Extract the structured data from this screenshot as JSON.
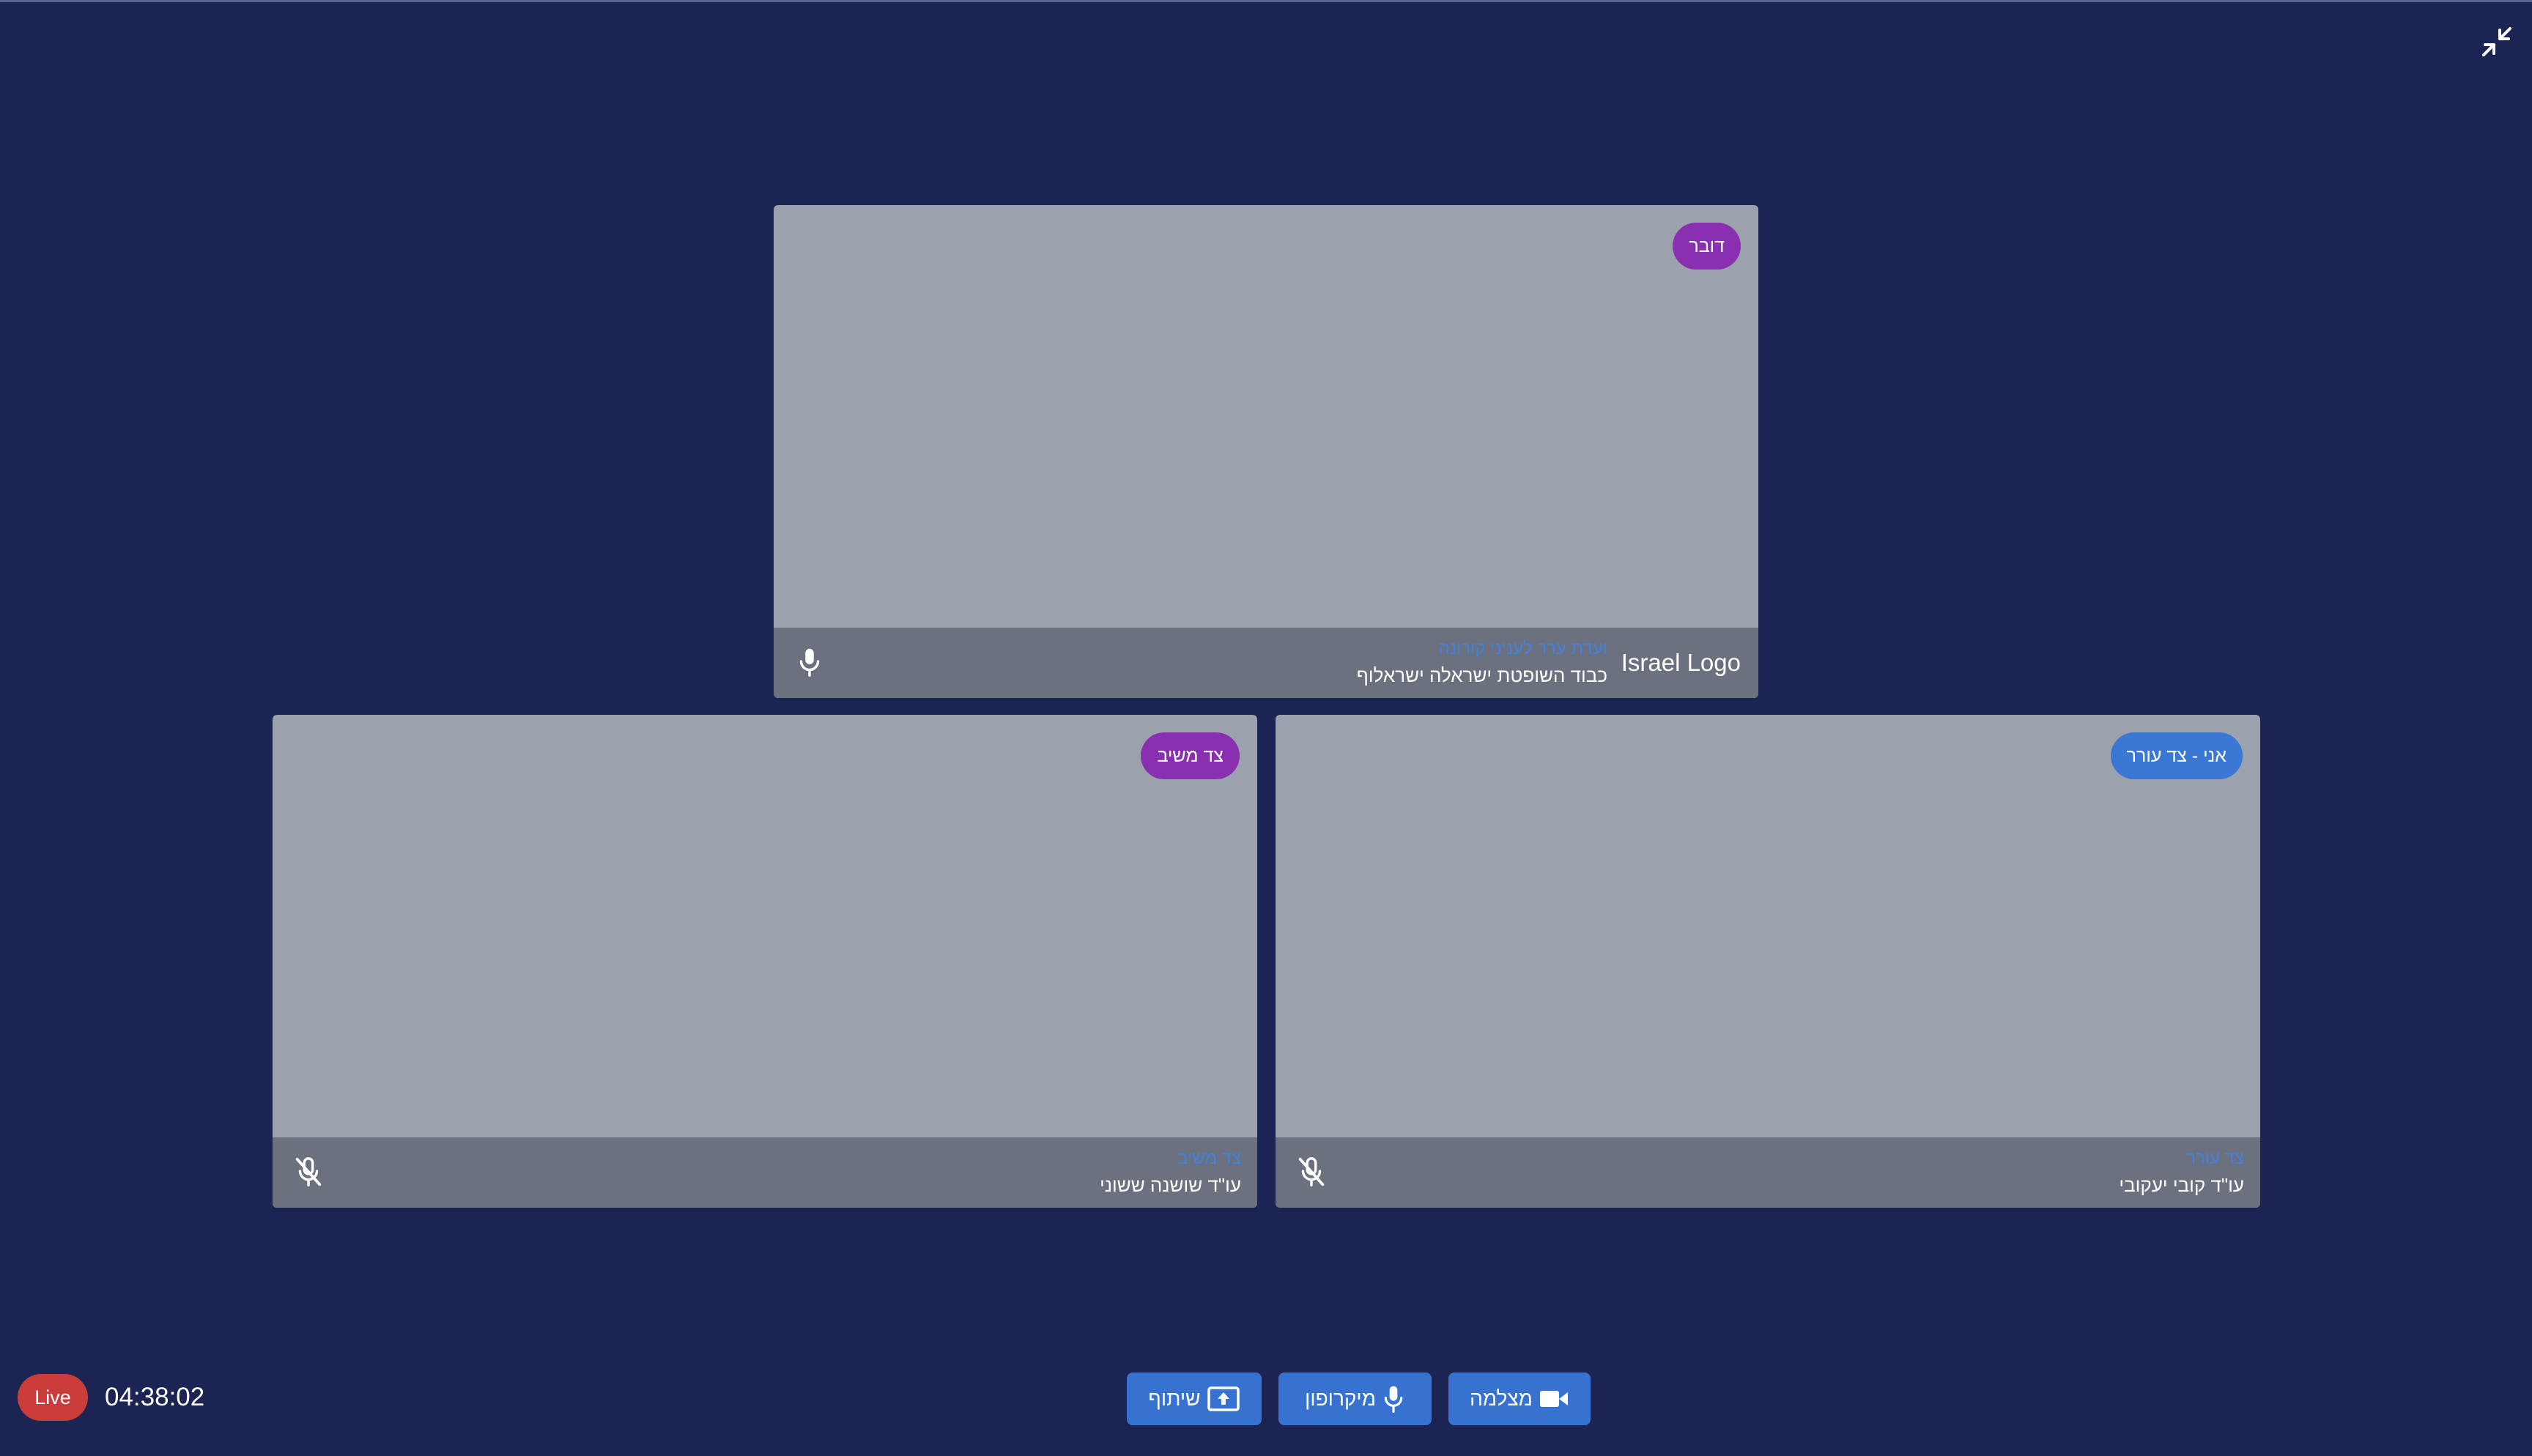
{
  "toolbar": {
    "exit_fullscreen_icon": "exit-fullscreen-icon"
  },
  "tiles": {
    "top": {
      "role_badge": "דובר",
      "group": "ועדת ערר לעניני קורונה",
      "person": "כבוד השופטת ישראלה ישראלוף",
      "logo_text": "Israel Logo",
      "mic_state": "on",
      "mic_icon": "microphone-icon"
    },
    "left": {
      "role_badge": "צד משיב",
      "group": "צד משיב",
      "person": "עו\"ד שושנה ששוני",
      "mic_state": "muted",
      "mic_icon": "microphone-off-icon"
    },
    "right": {
      "role_badge": "אני - צד עורר",
      "group": "צד עורר",
      "person": "עו\"ד קובי יעקובי",
      "mic_state": "muted",
      "mic_icon": "microphone-off-icon"
    }
  },
  "status": {
    "live_label": "Live",
    "elapsed": "04:38:02"
  },
  "controls": {
    "share_label": "שיתוף",
    "share_icon": "screen-share-icon",
    "mic_label": "מיקרופון",
    "mic_icon": "microphone-icon",
    "camera_label": "מצלמה",
    "camera_icon": "video-camera-icon"
  },
  "colors": {
    "background": "#1b2453",
    "tile": "#9ca2ad",
    "info_bar": "#6b717e",
    "pill_purple": "#8a2fb0",
    "pill_blue": "#3b78d4",
    "group_text": "#3f82e0",
    "live": "#c93c3a",
    "control_button": "#3772d0"
  }
}
